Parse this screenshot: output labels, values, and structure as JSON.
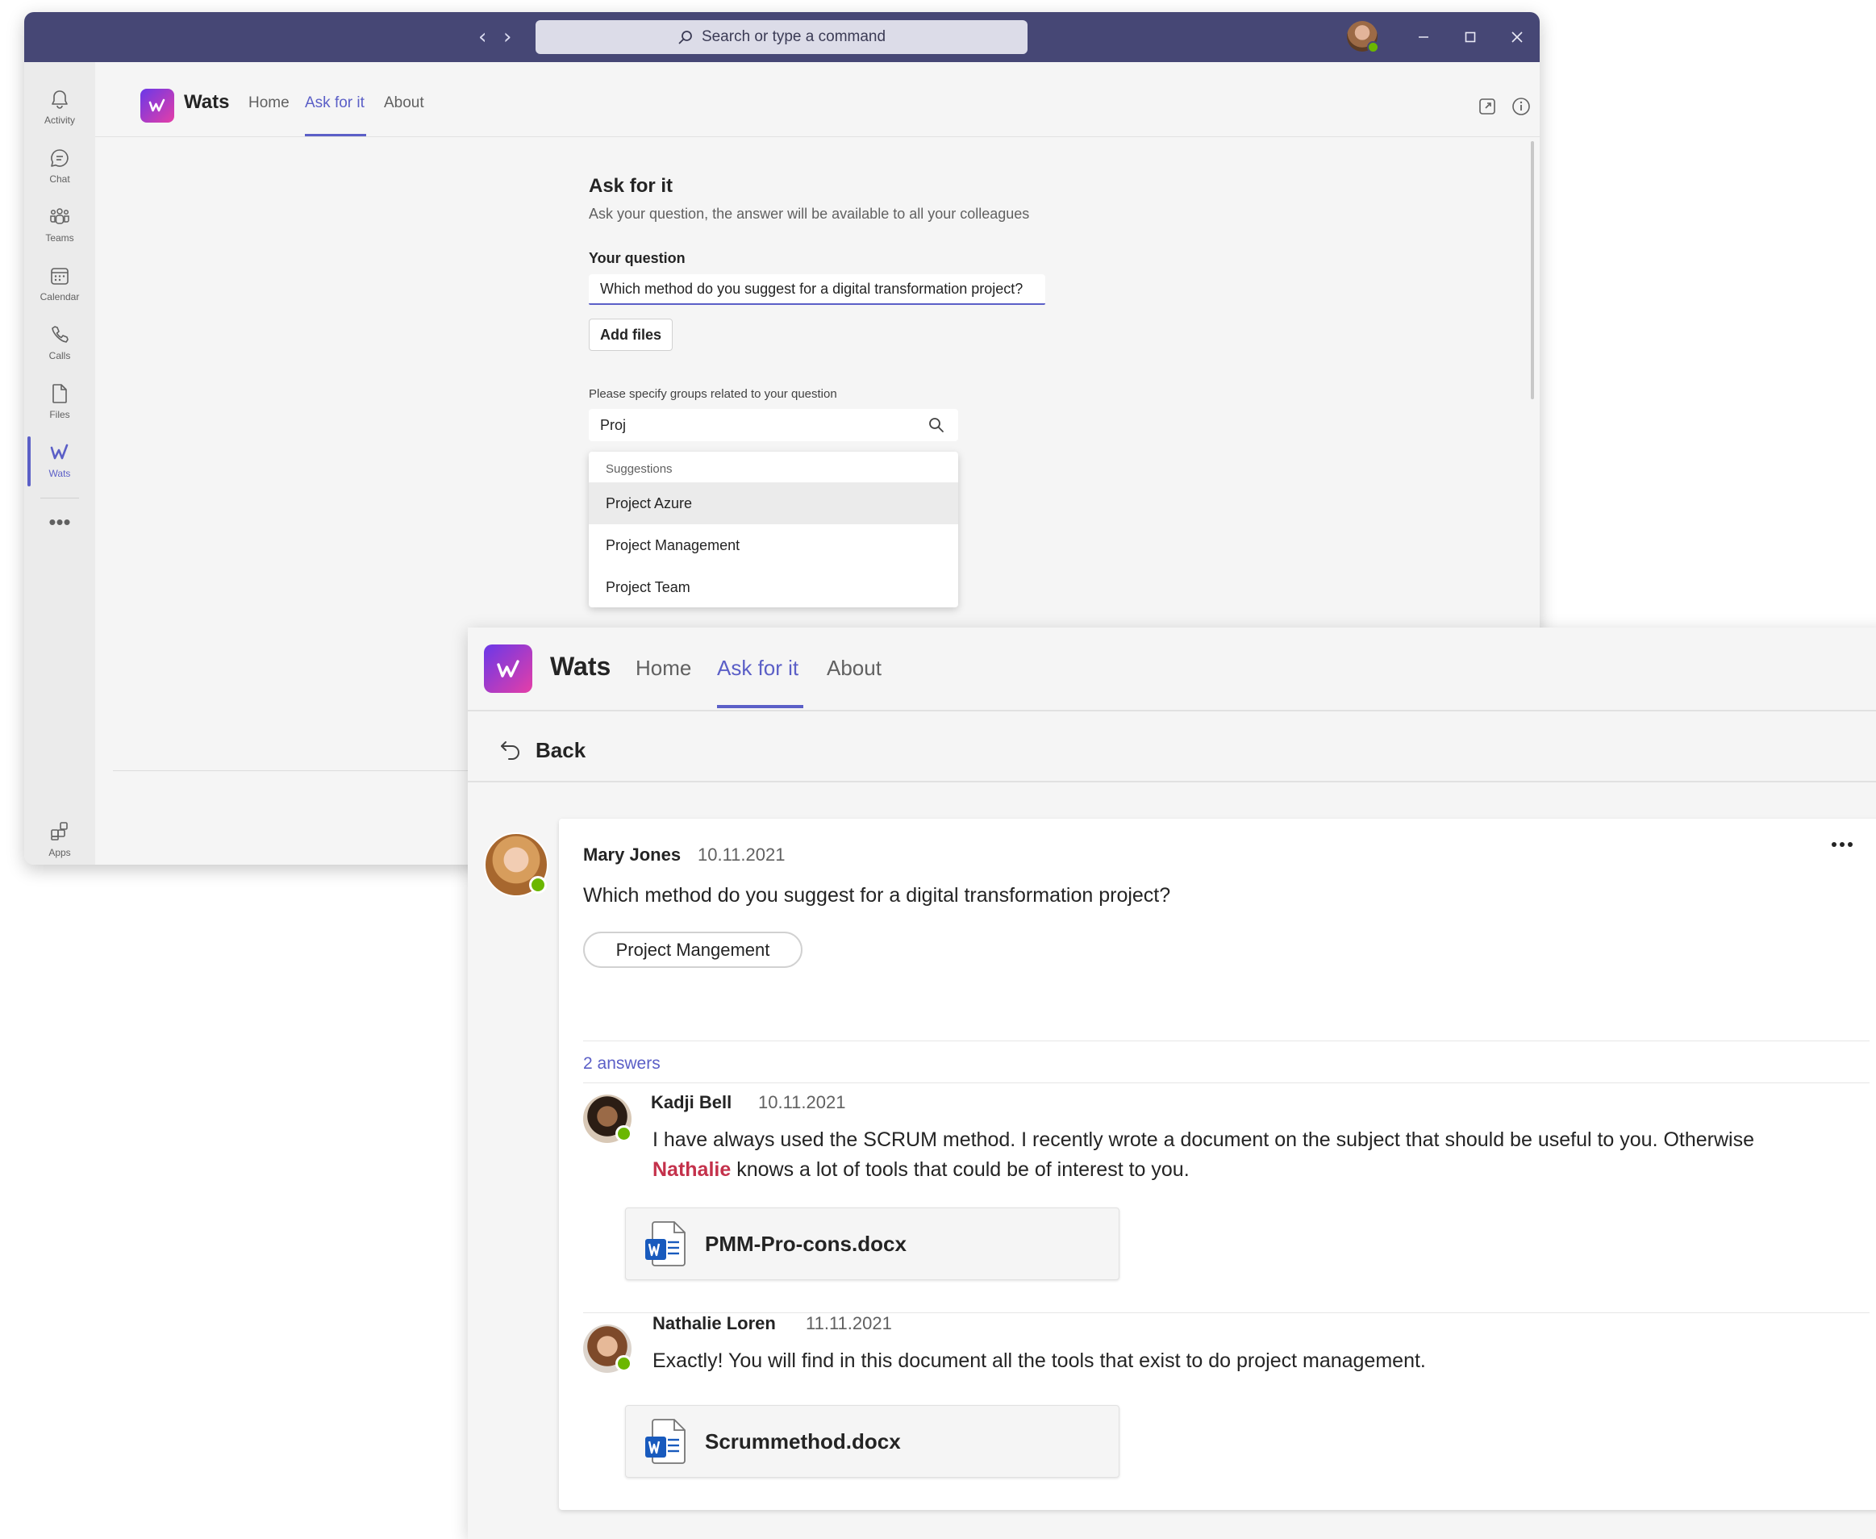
{
  "teams": {
    "search_placeholder": "Search or type a command",
    "rail": [
      {
        "label": "Activity",
        "icon": "bell-icon"
      },
      {
        "label": "Chat",
        "icon": "chat-icon"
      },
      {
        "label": "Teams",
        "icon": "teams-icon"
      },
      {
        "label": "Calendar",
        "icon": "calendar-icon"
      },
      {
        "label": "Calls",
        "icon": "phone-icon"
      },
      {
        "label": "Files",
        "icon": "file-icon"
      },
      {
        "label": "Wats",
        "icon": "wats-icon",
        "active": true
      },
      {
        "label": "Apps",
        "icon": "apps-icon"
      }
    ],
    "accent": "#5b5fc7",
    "titlebar_color": "#464775"
  },
  "app": {
    "name": "Wats",
    "tabs": [
      "Home",
      "Ask for it",
      "About"
    ],
    "active_tab": "Ask for it"
  },
  "ask_form": {
    "title": "Ask for it",
    "subtitle": "Ask your question, the answer will be available to all your colleagues",
    "question_label": "Your question",
    "question_value": "Which method do you suggest for a digital transformation project?",
    "add_files_label": "Add files",
    "groups_label": "Please specify groups related to your question",
    "groups_value": "Proj",
    "suggestions_header": "Suggestions",
    "suggestions": [
      "Project Azure",
      "Project Management",
      "Project Team"
    ]
  },
  "thread": {
    "back_label": "Back",
    "question": {
      "author": "Mary Jones",
      "date": "10.11.2021",
      "text": "Which method do you suggest for a digital transformation project?",
      "tag": "Project Mangement"
    },
    "answers_count": "2 answers",
    "answers": [
      {
        "author": "Kadji Bell",
        "date": "10.11.2021",
        "text_part1": "I have always used the SCRUM method. I recently wrote a document on the subject that should be useful to you. Otherwise",
        "mention": "Nathalie",
        "text_part2": " knows a lot of tools that could be of interest to you.",
        "file": "PMM-Pro-cons.docx"
      },
      {
        "author": "Nathalie Loren",
        "date": "11.11.2021",
        "text": "Exactly! You will find in this document all the tools that exist to do project management.",
        "file": "Scrummethod.docx"
      }
    ],
    "mention_color": "#c4314b",
    "presence_color": "#6bb700"
  }
}
